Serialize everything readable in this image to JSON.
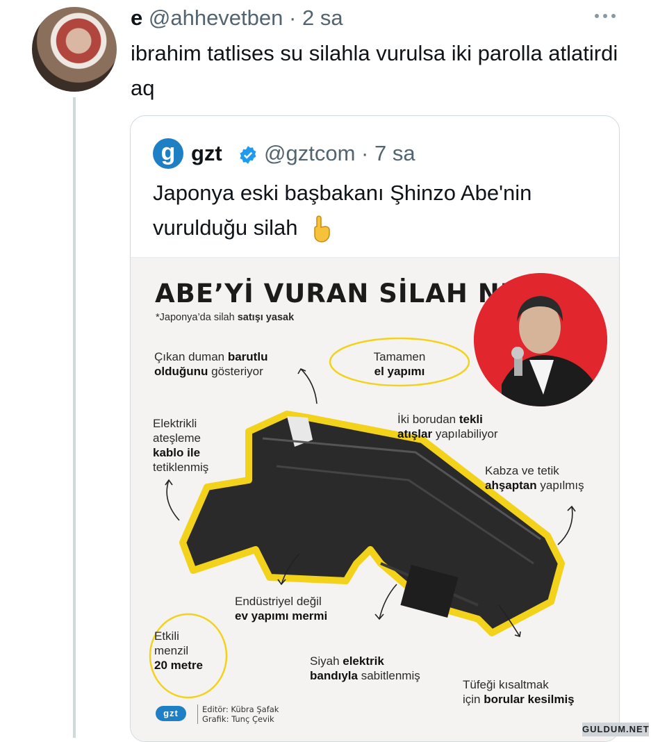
{
  "tweet": {
    "author_name": "e",
    "handle": "@ahhevetben",
    "separator": "·",
    "time": "2 sa",
    "text": "ibrahim tatlises su silahla vurulsa iki parolla atlatirdi aq",
    "avatar_icon": "user-avatar",
    "more_icon": "more-dots-icon"
  },
  "quote": {
    "author_name": "gzt",
    "logo_letter": "g",
    "verified_icon": "verified-badge-icon",
    "handle": "@gztcom",
    "separator": "·",
    "time": "7 sa",
    "text": "Japonya eski başbakanı Şhinzo Abe'nin vurulduğu silah",
    "emoji_icon": "pointing-down-hand-icon"
  },
  "infographic": {
    "title": "ABE’Yİ VURAN SİLAH NE?",
    "subtitle_plain": "*Japonya’da silah ",
    "subtitle_bold": "satışı yasak",
    "labels": {
      "smoke_1": "Çıkan duman ",
      "smoke_2": "barutlu",
      "smoke_3": "olduğunu",
      "smoke_4": " gösteriyor",
      "handmade_1": "Tamamen",
      "handmade_2": "el yapımı",
      "electric_1": "Elektrikli",
      "electric_2": "ateşleme",
      "electric_3": "kablo ile",
      "electric_4": "tetiklenmiş",
      "barrels_1": "İki borudan ",
      "barrels_2": "tekli",
      "barrels_3": "atışlar",
      "barrels_4": " yapılabiliyor",
      "grip_1": "Kabza ve tetik",
      "grip_2": "ahşaptan",
      "grip_3": " yapılmış",
      "ammo_1": "Endüstriyel değil",
      "ammo_2": "ev yapımı mermi",
      "range_1": "Etkili",
      "range_2": "menzil",
      "range_3": "20 metre",
      "tape_1": "Siyah ",
      "tape_2": "elektrik",
      "tape_3": "bandıyla",
      "tape_4": " sabitlenmiş",
      "cut_1": "Tüfeği kısaltmak",
      "cut_2": "için ",
      "cut_3": "borular kesilmiş"
    },
    "credit_logo": "gzt",
    "credit_editor": "Editör: Kübra Şafak",
    "credit_graphic": "Grafik: Tunç Çevik",
    "colors": {
      "highlight": "#f2d21a",
      "portrait_bg": "#e2262e"
    }
  },
  "watermark": "GULDUM.NET"
}
